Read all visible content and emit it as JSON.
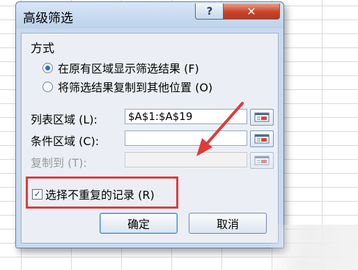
{
  "dialog": {
    "title": "高级筛选",
    "help_label": "?",
    "close_label": "✕"
  },
  "method": {
    "group_label": "方式",
    "options": [
      {
        "label": "在原有区域显示筛选结果 (F)",
        "selected": true
      },
      {
        "label": "将筛选结果复制到其他位置 (O)",
        "selected": false
      }
    ]
  },
  "fields": {
    "list_range": {
      "label": "列表区域 (L):",
      "value": "$A$1:$A$19"
    },
    "criteria_range": {
      "label": "条件区域 (C):",
      "value": ""
    },
    "copy_to": {
      "label": "复制到 (T):",
      "value": "",
      "disabled": true
    }
  },
  "unique_records": {
    "label": "选择不重复的记录 (R)",
    "checked": true,
    "check_glyph": "✓"
  },
  "buttons": {
    "ok": "确定",
    "cancel": "取消"
  },
  "colors": {
    "highlight": "#e03a3a",
    "dialog_frame": "#c9daf0",
    "close_button": "#c94428"
  },
  "icons": [
    "help-icon",
    "close-icon",
    "collapse-dialog-icon",
    "annotation-arrow"
  ]
}
